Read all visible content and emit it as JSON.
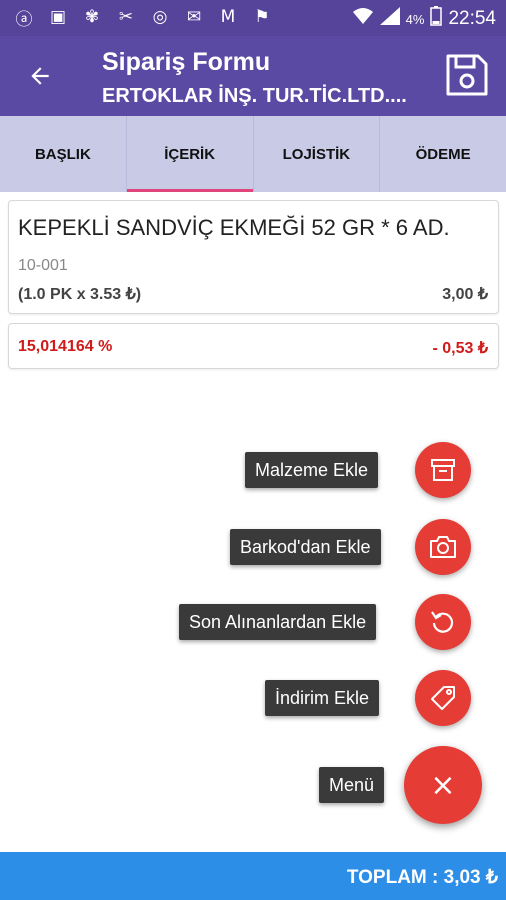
{
  "status_bar": {
    "icons": [
      "app-icon-1",
      "image-icon",
      "app-icon-2",
      "app-icon-3",
      "instagram-icon",
      "mail-icon",
      "gmail-icon",
      "flag-icon"
    ],
    "wifi_icon": "wifi-icon",
    "signal_icon": "signal-icon",
    "battery_percent": "4%",
    "time": "22:54"
  },
  "app_bar": {
    "title": "Sipariş Formu",
    "subtitle": "ERTOKLAR İNŞ. TUR.TİC.LTD....",
    "back_icon": "arrow-back-icon",
    "save_icon": "save-icon"
  },
  "tabs": [
    {
      "label": "BAŞLIK",
      "active": false
    },
    {
      "label": "İÇERİK",
      "active": true
    },
    {
      "label": "LOJİSTİK",
      "active": false
    },
    {
      "label": "ÖDEME",
      "active": false
    }
  ],
  "item": {
    "name": "KEPEKLİ SANDVİÇ EKMEĞİ 52 GR * 6 AD.",
    "code": "10-001",
    "quantity": "(1.0 PK x 3.53 ₺)",
    "price": "3,00 ₺"
  },
  "discount": {
    "percent": "15,014164 %",
    "amount": "- 0,53 ₺"
  },
  "fab_menu": {
    "items": [
      {
        "label": "Malzeme Ekle",
        "icon": "archive-icon"
      },
      {
        "label": "Barkod'dan Ekle",
        "icon": "camera-icon"
      },
      {
        "label": "Son Alınanlardan Ekle",
        "icon": "history-icon"
      },
      {
        "label": "İndirim Ekle",
        "icon": "tag-icon"
      }
    ],
    "main_label": "Menü",
    "main_symbol": "×"
  },
  "total": "TOPLAM : 3,03 ₺",
  "colors": {
    "primary": "#5a4aa3",
    "tabs_bg": "#c9cbe6",
    "tab_indicator": "#e0457b",
    "fab": "#e53c35",
    "discount_text": "#d11b1b",
    "total_bar": "#2d8ee8"
  }
}
